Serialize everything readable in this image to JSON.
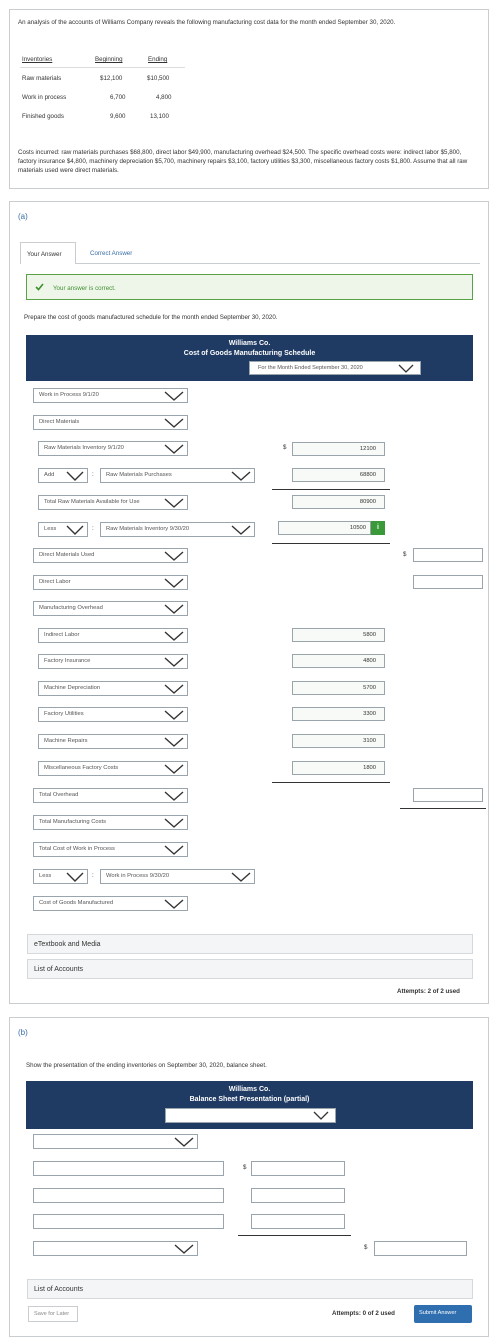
{
  "problem": {
    "intro": "An analysis of the accounts of Williams Company reveals the following manufacturing cost data for the month ended September 30, 2020.",
    "table": {
      "headers": [
        "Inventories",
        "Beginning",
        "Ending"
      ],
      "rows": [
        {
          "label": "Raw materials",
          "beginning": "$12,100",
          "ending": "$10,500"
        },
        {
          "label": "Work in process",
          "beginning": "6,700",
          "ending": "4,800"
        },
        {
          "label": "Finished goods",
          "beginning": "9,600",
          "ending": "13,100"
        }
      ]
    },
    "costs": "Costs incurred: raw materials purchases $68,800, direct labor $49,900, manufacturing overhead $24,500. The specific overhead costs were: indirect labor $5,800, factory insurance $4,800, machinery depreciation $5,700, machinery repairs $3,100, factory utilities $3,300, miscellaneous factory costs $1,800. Assume that all raw materials used were direct materials."
  },
  "part_a": {
    "label": "(a)",
    "tabs": [
      "Your Answer",
      "Correct Answer"
    ],
    "correct_msg": "Your answer is correct.",
    "instruction": "Prepare the cost of goods manufactured schedule for the month ended September 30, 2020.",
    "header": {
      "company": "Williams Co.",
      "title": "Cost of Goods Manufacturing Schedule",
      "period": "For the Month Ended September 30, 2020"
    },
    "rows": {
      "wip_begin": "Work in Process 9/1/20",
      "direct_materials": "Direct Materials",
      "rm_begin": "Raw Materials Inventory 9/1/20",
      "add": "Add",
      "rm_purchases": "Raw Materials Purchases",
      "total_rm": "Total Raw Materials Available for Use",
      "less": "Less",
      "rm_end": "Raw Materials Inventory 9/30/20",
      "dm_used": "Direct Materials Used",
      "direct_labor": "Direct Labor",
      "mfg_overhead": "Manufacturing Overhead",
      "indirect_labor": "Indirect Labor",
      "factory_insurance": "Factory Insurance",
      "machine_depreciation": "Machine Depreciation",
      "factory_utilities": "Factory Utilities",
      "machine_repairs": "Machine Repairs",
      "misc_costs": "Miscellaneous Factory Costs",
      "total_overhead": "Total Overhead",
      "total_mfg_costs": "Total Manufacturing Costs",
      "total_wip": "Total Cost of Work in Process",
      "less2": "Less",
      "wip_end": "Work in Process 9/30/20",
      "cogm": "Cost of Goods Manufactured"
    },
    "values": {
      "rm_begin": "12100",
      "rm_purchases": "68800",
      "total_rm": "80900",
      "rm_end": "10500",
      "indirect_labor": "5800",
      "factory_insurance": "4800",
      "machine_depreciation": "5700",
      "factory_utilities": "3300",
      "machine_repairs": "3100",
      "misc_costs": "1800"
    },
    "dollar": "$",
    "colon": ":",
    "info": "i",
    "links": [
      "eTextbook and Media",
      "List of Accounts"
    ],
    "attempts": "Attempts: 2 of 2 used"
  },
  "part_b": {
    "label": "(b)",
    "instruction": "Show the presentation of the ending inventories on September 30, 2020, balance sheet.",
    "header": {
      "company": "Williams Co.",
      "title": "Balance Sheet Presentation (partial)"
    },
    "dollar": "$",
    "link": "List of Accounts",
    "save": "Save for Later",
    "attempts": "Attempts: 0 of 2 used",
    "submit": "Submit Answer"
  },
  "colors": {
    "header_bg": "#1f3a63",
    "success_bg": "#eef6ea",
    "success_border": "#5aa245",
    "check": "#3f8f2f",
    "submit_bg": "#2f6fb0",
    "info_bg": "#3a9a3a"
  }
}
